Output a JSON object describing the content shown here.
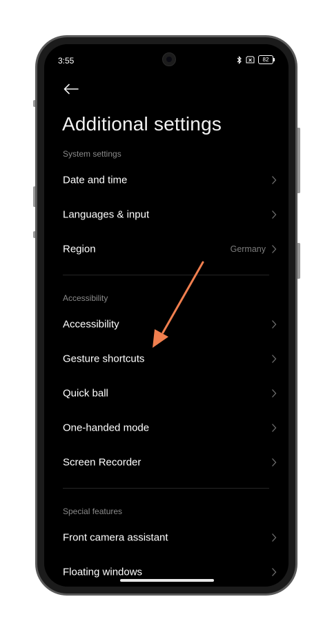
{
  "status_bar": {
    "time": "3:55",
    "battery": "82",
    "icons": [
      "bluetooth-icon",
      "sim-icon",
      "battery-icon"
    ]
  },
  "header": {
    "back_icon": "back-arrow-icon",
    "title": "Additional settings"
  },
  "sections": {
    "system": {
      "header": "System settings",
      "items": [
        {
          "label": "Date and time"
        },
        {
          "label": "Languages & input"
        },
        {
          "label": "Region",
          "value": "Germany"
        }
      ]
    },
    "accessibility": {
      "header": "Accessibility",
      "items": [
        {
          "label": "Accessibility"
        },
        {
          "label": "Gesture shortcuts"
        },
        {
          "label": "Quick ball"
        },
        {
          "label": "One-handed mode"
        },
        {
          "label": "Screen Recorder"
        }
      ]
    },
    "special": {
      "header": "Special features",
      "items": [
        {
          "label": "Front camera assistant"
        },
        {
          "label": "Floating windows"
        }
      ]
    }
  },
  "annotation": {
    "arrow_color": "#f07f4f",
    "points_to": "Gesture shortcuts"
  },
  "colors": {
    "screen_bg": "#000000",
    "text": "#ffffff",
    "section_header": "#8a8a8a",
    "secondary_value": "#7c7c7c"
  }
}
